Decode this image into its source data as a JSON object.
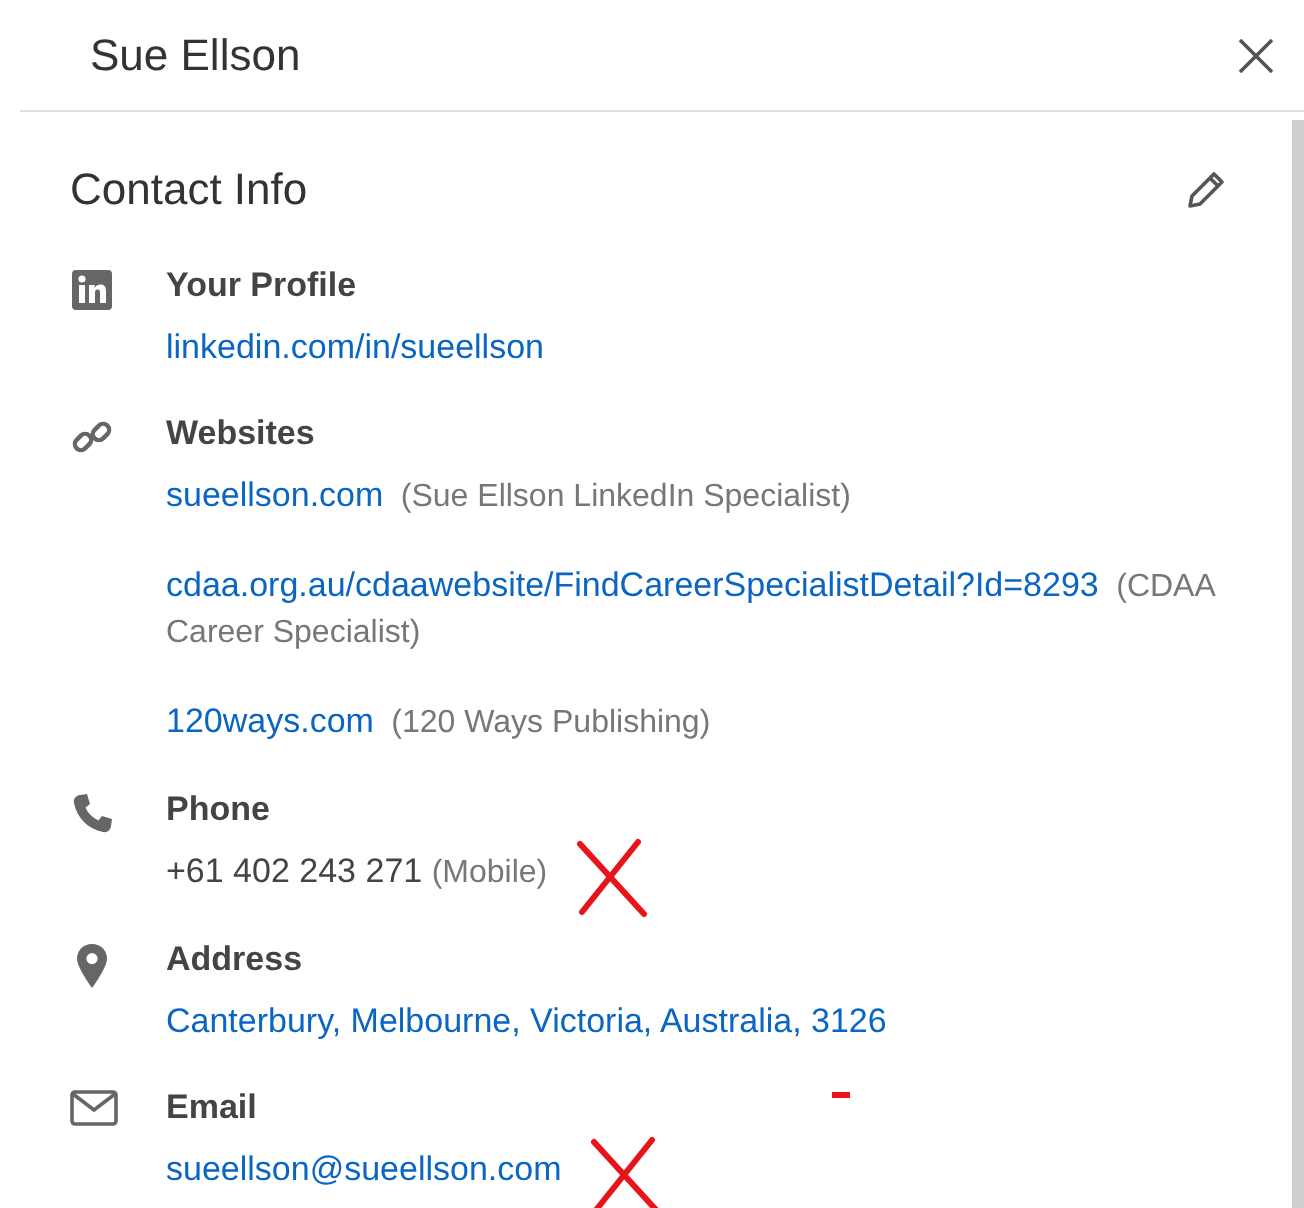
{
  "dialog": {
    "title": "Sue Ellson"
  },
  "section": {
    "title": "Contact Info"
  },
  "groups": [
    {
      "kind": "profile",
      "title": "Your Profile",
      "entries": [
        {
          "text": "linkedin.com/in/sueellson",
          "link": true
        }
      ]
    },
    {
      "kind": "websites",
      "title": "Websites",
      "entries": [
        {
          "text": "sueellson.com",
          "link": true,
          "note": "(Sue Ellson LinkedIn Specialist)"
        },
        {
          "text": "cdaa.org.au/cdaawebsite/FindCareerSpecialistDetail?Id=8293",
          "link": true,
          "note": "(CDAA Career Specialist)"
        },
        {
          "text": "120ways.com",
          "link": true,
          "note": "(120 Ways Publishing)"
        }
      ]
    },
    {
      "kind": "phone",
      "title": "Phone",
      "entries": [
        {
          "text": "+61 402 243 271",
          "link": false,
          "note": "(Mobile)",
          "crossed_out": true
        }
      ]
    },
    {
      "kind": "address",
      "title": "Address",
      "entries": [
        {
          "text": "Canterbury, Melbourne, Victoria, Australia, 3126",
          "link": true
        }
      ]
    },
    {
      "kind": "email",
      "title": "Email",
      "dash_mark": true,
      "entries": [
        {
          "text": "sueellson@sueellson.com",
          "link": true,
          "crossed_out": true
        }
      ]
    }
  ]
}
